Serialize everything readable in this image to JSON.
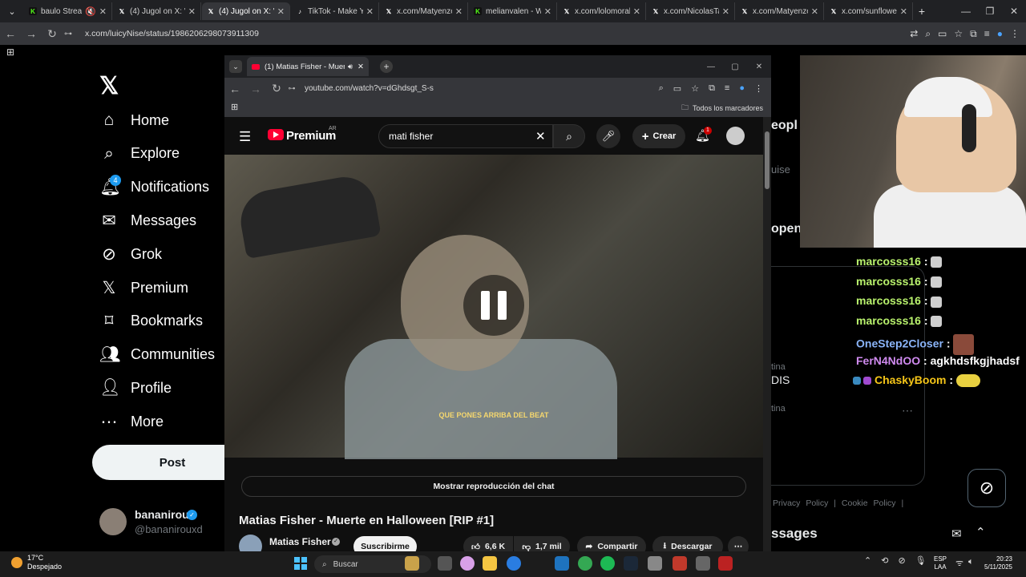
{
  "browser": {
    "tabs": [
      {
        "label": "baulo Stream",
        "color": "#53fc18",
        "fav": "K",
        "muted": "🔇"
      },
      {
        "label": "(4) Jugol on X: \"A",
        "color": "#fff",
        "fav": "𝕏"
      },
      {
        "label": "(4) Jugol on X: \"N",
        "color": "#fff",
        "fav": "𝕏",
        "active": true
      },
      {
        "label": "TikTok - Make You",
        "color": "#fff",
        "fav": "♪"
      },
      {
        "label": "x.com/Matyenzo",
        "color": "#fff",
        "fav": "𝕏"
      },
      {
        "label": "melianvalen - Wa",
        "color": "#53fc18",
        "fav": "K"
      },
      {
        "label": "x.com/lolomorale",
        "color": "#fff",
        "fav": "𝕏"
      },
      {
        "label": "x.com/NicolasTap",
        "color": "#fff",
        "fav": "𝕏"
      },
      {
        "label": "x.com/Matyenzo",
        "color": "#fff",
        "fav": "𝕏"
      },
      {
        "label": "x.com/sunflower",
        "color": "#fff",
        "fav": "𝕏"
      }
    ],
    "url": "x.com/luicyNise/status/1986206298073911309"
  },
  "x_sidebar": {
    "nav": [
      {
        "icon": "⌂",
        "label": "Home",
        "name": "home"
      },
      {
        "icon": "⌕",
        "label": "Explore",
        "name": "explore"
      },
      {
        "icon": "🔔︎",
        "label": "Notifications",
        "name": "notifications"
      },
      {
        "icon": "✉",
        "label": "Messages",
        "name": "messages"
      },
      {
        "icon": "⊘",
        "label": "Grok",
        "name": "grok"
      },
      {
        "icon": "𝕏",
        "label": "Premium",
        "name": "premium"
      },
      {
        "icon": "⌑",
        "label": "Bookmarks",
        "name": "bookmarks"
      },
      {
        "icon": "👥︎",
        "label": "Communities",
        "name": "communities"
      },
      {
        "icon": "👤︎",
        "label": "Profile",
        "name": "profile"
      },
      {
        "icon": "⋯",
        "label": "More",
        "name": "more"
      }
    ],
    "notif_badge": "4",
    "post_label": "Post",
    "user_name": "bananirou",
    "user_handle": "@bananirouxd"
  },
  "youtube_window": {
    "tab_title": "(1) Matias Fisher - Muerte e",
    "url": "youtube.com/watch?v=dGhdsgt_S-s",
    "bookmarks_label": "Todos los marcadores",
    "logo_text": "Premium",
    "region": "AR",
    "search_value": "mati fisher",
    "create_label": "Crear",
    "notif_count": "1",
    "subtitle": "QUE PONES ARRIBA DEL BEAT",
    "chat_replay": "Mostrar reproducción del chat",
    "video_title": "Matias Fisher - Muerte en Halloween [RIP #1]",
    "channel": "Matias Fisher",
    "subscribe": "Suscribirme",
    "likes": "6,6 K",
    "dislikes": "1,7 mil",
    "share": "Compartir",
    "download": "Descargar"
  },
  "stream_chat": [
    {
      "user": "marcosss16",
      "color": "#b9f26d",
      "msg": "",
      "emote": "#cfcfcf"
    },
    {
      "user": "marcosss16",
      "color": "#b9f26d",
      "msg": "",
      "emote": "#cfcfcf"
    },
    {
      "user": "marcosss16",
      "color": "#b9f26d",
      "msg": "",
      "emote": "#cfcfcf"
    },
    {
      "user": "marcosss16",
      "color": "#b9f26d",
      "msg": "",
      "emote": "#cfcfcf"
    },
    {
      "user": "OneStep2Closer",
      "color": "#8ab4f8",
      "msg": "",
      "emote": "#8a4a3a"
    },
    {
      "user": "FerN4NdOO",
      "color": "#d08bf0",
      "msg": "agkhdsfkgjhadsf",
      "emote": ""
    },
    {
      "user": "ChaskyBoom",
      "color": "#f5c518",
      "msg": "",
      "emote": "#e8d040"
    }
  ],
  "x_right": {
    "frag1": "eopl",
    "frag2": "uise",
    "frag3": "open",
    "frag4": "tina",
    "frag5": "DIS",
    "frag6": "tina",
    "links": "Privacy Policy | Cookie Policy |",
    "messages": "ssages"
  },
  "taskbar": {
    "temp": "17°C",
    "weather": "Despejado",
    "search": "Buscar",
    "lang1": "ESP",
    "lang2": "LAA",
    "time": "20:23",
    "date": "5/11/2025"
  }
}
